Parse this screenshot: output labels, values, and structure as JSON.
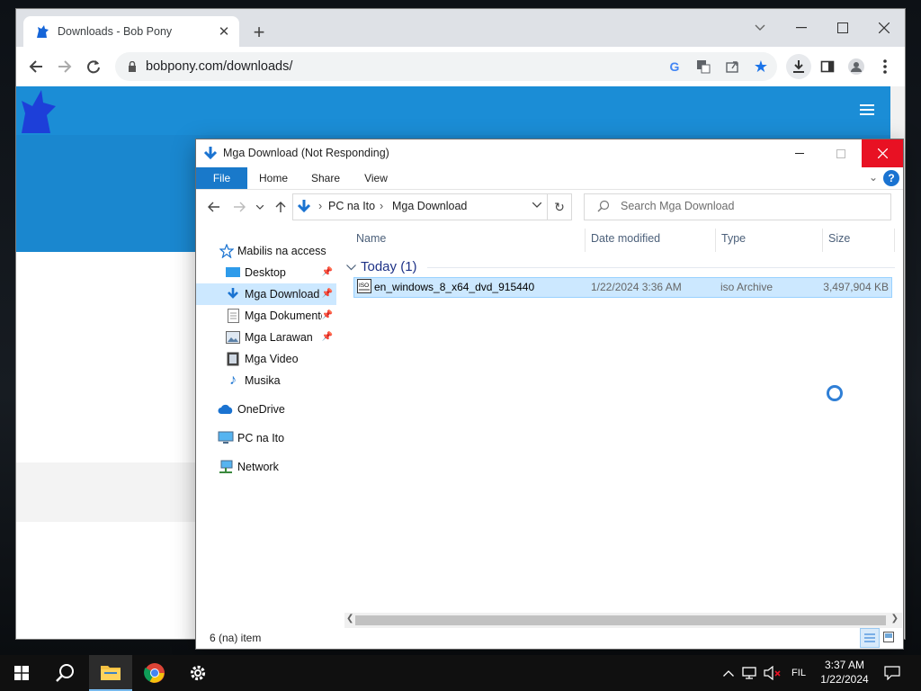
{
  "browser": {
    "tab_title": "Downloads - Bob Pony",
    "url": "bobpony.com/downloads/"
  },
  "explorer": {
    "title": "Mga Download (Not Responding)",
    "ribbon_tabs": [
      "File",
      "Home",
      "Share",
      "View"
    ],
    "address": {
      "segment1": "PC na Ito",
      "segment2": "Mga Download"
    },
    "search_placeholder": "Search Mga Download",
    "nav_pane": {
      "quick_access": "Mabilis na access",
      "items": [
        {
          "label": "Desktop",
          "pinned": true
        },
        {
          "label": "Mga Download",
          "pinned": true,
          "selected": true
        },
        {
          "label": "Mga Dokumento",
          "pinned": true
        },
        {
          "label": "Mga Larawan",
          "pinned": true
        },
        {
          "label": "Mga Video",
          "pinned": false
        },
        {
          "label": "Musika",
          "pinned": false
        }
      ],
      "onedrive": "OneDrive",
      "this_pc": "PC na Ito",
      "network": "Network"
    },
    "columns": {
      "name": "Name",
      "date": "Date modified",
      "type": "Type",
      "size": "Size"
    },
    "group_label": "Today (1)",
    "file": {
      "name": "en_windows_8_x64_dvd_915440",
      "date": "1/22/2024 3:36 AM",
      "type": "iso Archive",
      "size": "3,497,904 KB",
      "icon_text": "ISO"
    },
    "status": "6 (na) item"
  },
  "taskbar": {
    "language": "FIL",
    "time": "3:37 AM",
    "date": "1/22/2024"
  },
  "colors": {
    "accent": "#1979ca",
    "close": "#e81123",
    "selection": "#cce8ff",
    "page_header": "#1b8dd6"
  }
}
